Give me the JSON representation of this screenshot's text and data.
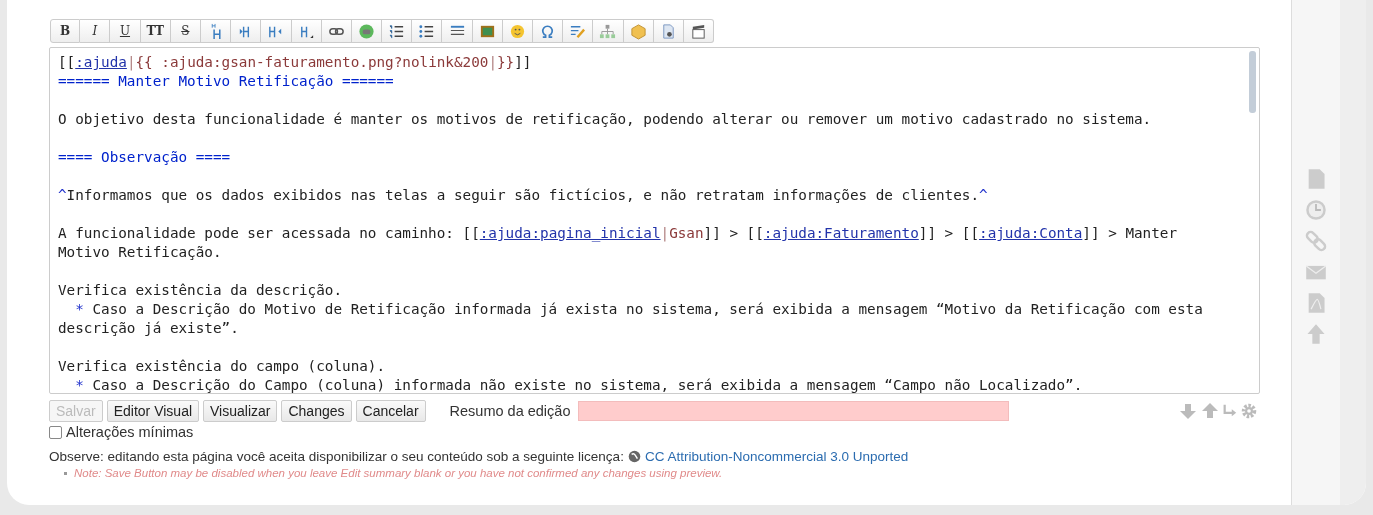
{
  "toolbar": [
    {
      "label": "B",
      "kind": "bold"
    },
    {
      "label": "I",
      "kind": "italic"
    },
    {
      "label": "U",
      "kind": "underline"
    },
    {
      "label": "TT",
      "kind": "mono"
    },
    {
      "label": "S",
      "kind": "strike"
    }
  ],
  "editor": {
    "lines": [
      {
        "paragraph_start": false,
        "segments": [
          {
            "kind": "text",
            "text": "[["
          },
          {
            "kind": "link",
            "text": ":ajuda"
          },
          {
            "kind": "pipe",
            "text": "|"
          },
          {
            "kind": "media",
            "text": "{{ :ajuda:gsan-faturamento.png?nolink&200"
          },
          {
            "kind": "pipe",
            "text": "|"
          },
          {
            "kind": "media",
            "text": "}}"
          },
          {
            "kind": "text",
            "text": "]]"
          }
        ]
      },
      {
        "paragraph_start": false,
        "segments": [
          {
            "kind": "heading",
            "text": "====== Manter Motivo Retificação ======"
          }
        ]
      },
      {
        "paragraph_start": true,
        "segments": [
          {
            "kind": "text",
            "text": "O objetivo desta funcionalidade é manter os motivos de retificação, podendo alterar ou remover um motivo cadastrado no sistema."
          }
        ]
      },
      {
        "paragraph_start": true,
        "segments": [
          {
            "kind": "heading",
            "text": "==== Observação ===="
          }
        ]
      },
      {
        "paragraph_start": true,
        "segments": [
          {
            "kind": "caret",
            "text": "^"
          },
          {
            "kind": "text",
            "text": "Informamos que os dados exibidos nas telas a seguir são fictícios, e não retratam informações de clientes."
          },
          {
            "kind": "caret",
            "text": "^"
          }
        ]
      },
      {
        "paragraph_start": true,
        "segments": [
          {
            "kind": "text",
            "text": "A funcionalidade pode ser acessada no caminho: [["
          },
          {
            "kind": "link",
            "text": ":ajuda:pagina_inicial"
          },
          {
            "kind": "pipe",
            "text": "|"
          },
          {
            "kind": "media",
            "text": "Gsan"
          },
          {
            "kind": "text",
            "text": "]] > [["
          },
          {
            "kind": "link",
            "text": ":ajuda:Faturamento"
          },
          {
            "kind": "text",
            "text": "]] > [["
          },
          {
            "kind": "link",
            "text": ":ajuda:Conta"
          },
          {
            "kind": "text",
            "text": "]] > Manter"
          }
        ]
      },
      {
        "paragraph_start": false,
        "segments": [
          {
            "kind": "text",
            "text": "Motivo Retificação."
          }
        ]
      },
      {
        "paragraph_start": true,
        "segments": [
          {
            "kind": "text",
            "text": "Verifica existência da descrição."
          }
        ]
      },
      {
        "paragraph_start": false,
        "segments": [
          {
            "kind": "bullet",
            "text": "*"
          },
          {
            "kind": "text",
            "text": " Caso a Descrição do Motivo de Retificação informada já exista no sistema, será exibida a mensagem “Motivo da Retificação com esta"
          }
        ]
      },
      {
        "paragraph_start": false,
        "segments": [
          {
            "kind": "text",
            "text": "descrição já existe”."
          }
        ]
      },
      {
        "paragraph_start": true,
        "segments": [
          {
            "kind": "text",
            "text": "Verifica existência do campo (coluna)."
          }
        ]
      },
      {
        "paragraph_start": false,
        "segments": [
          {
            "kind": "bullet",
            "text": "*"
          },
          {
            "kind": "text",
            "text": " Caso a Descrição do Campo (coluna) informada não existe no sistema, será exibida a mensagem “Campo não Localizado”."
          }
        ]
      }
    ]
  },
  "buttons": [
    {
      "label": "Salvar",
      "disabled": true
    },
    {
      "label": "Editor Visual",
      "disabled": false
    },
    {
      "label": "Visualizar",
      "disabled": false
    },
    {
      "label": "Changes",
      "disabled": false
    },
    {
      "label": "Cancelar",
      "disabled": false
    }
  ],
  "summary": {
    "label": "Resumo da edição",
    "invalid": true
  },
  "minor_edit": {
    "label": "Alterações mínimas",
    "checked": false
  },
  "license": {
    "text": "Observe: editando esta página você aceita disponibilizar o seu conteúdo sob a seguinte licença:",
    "link": "CC Attribution-Noncommercial 3.0 Unported"
  },
  "note": "Note: Save Button may be disabled when you leave Edit summary blank or you have not confirmed any changes using preview."
}
